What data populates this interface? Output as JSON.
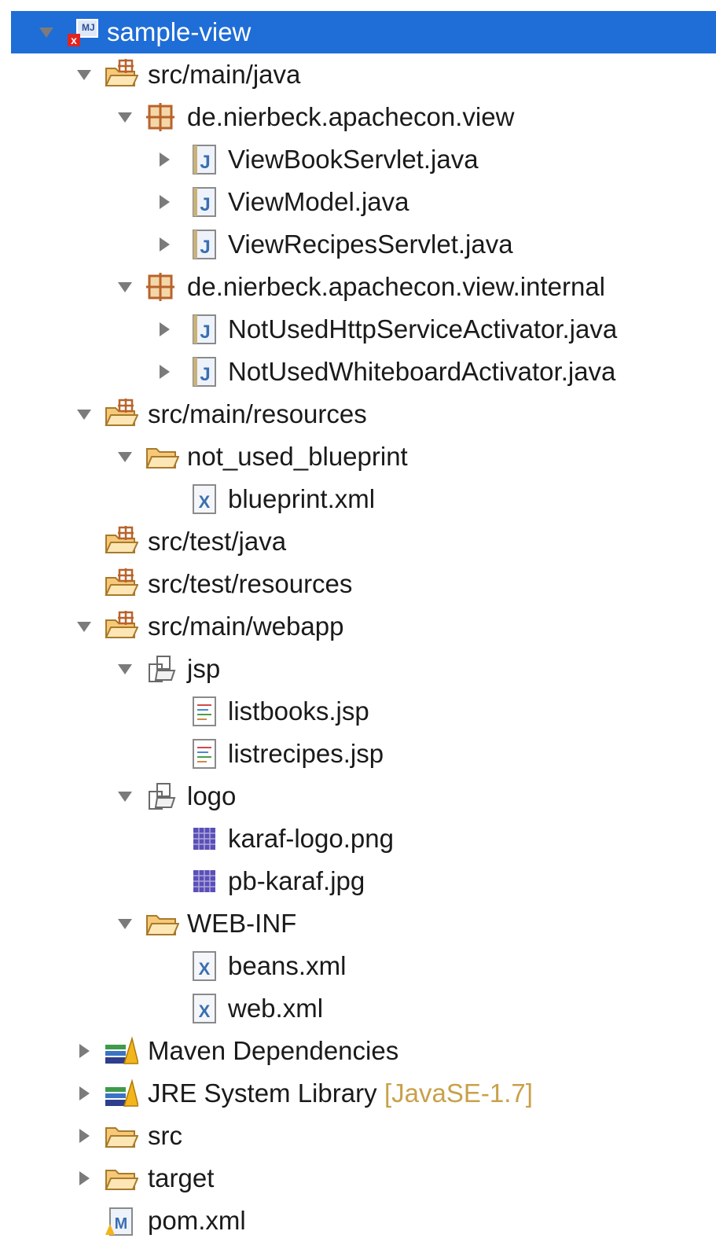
{
  "colors": {
    "selection": "#1f6dd6",
    "decoration": "#c8a14a",
    "folder": "#f6c97a",
    "package": "#b9632b",
    "java": "#3a6fb0",
    "image": "#5b4fb8"
  },
  "tree": [
    {
      "label": "sample-view",
      "icon": "maven-project-icon",
      "toggle": "expanded",
      "depth": 0,
      "selected": true
    },
    {
      "label": "src/main/java",
      "icon": "source-folder-icon",
      "toggle": "expanded",
      "depth": 1
    },
    {
      "label": "de.nierbeck.apachecon.view",
      "icon": "package-icon",
      "toggle": "expanded",
      "depth": 2
    },
    {
      "label": "ViewBookServlet.java",
      "icon": "java-file-icon",
      "toggle": "collapsed",
      "depth": 3
    },
    {
      "label": "ViewModel.java",
      "icon": "java-file-icon",
      "toggle": "collapsed",
      "depth": 3
    },
    {
      "label": "ViewRecipesServlet.java",
      "icon": "java-file-icon",
      "toggle": "collapsed",
      "depth": 3
    },
    {
      "label": "de.nierbeck.apachecon.view.internal",
      "icon": "package-icon",
      "toggle": "expanded",
      "depth": 2
    },
    {
      "label": "NotUsedHttpServiceActivator.java",
      "icon": "java-file-icon",
      "toggle": "collapsed",
      "depth": 3
    },
    {
      "label": "NotUsedWhiteboardActivator.java",
      "icon": "java-file-icon",
      "toggle": "collapsed",
      "depth": 3
    },
    {
      "label": "src/main/resources",
      "icon": "source-folder-icon",
      "toggle": "expanded",
      "depth": 1
    },
    {
      "label": "not_used_blueprint",
      "icon": "folder-icon",
      "toggle": "expanded",
      "depth": 2
    },
    {
      "label": "blueprint.xml",
      "icon": "xml-file-icon",
      "toggle": "none",
      "depth": 3
    },
    {
      "label": "src/test/java",
      "icon": "source-folder-icon",
      "toggle": "none",
      "depth": 1
    },
    {
      "label": "src/test/resources",
      "icon": "source-folder-icon",
      "toggle": "none",
      "depth": 1
    },
    {
      "label": "src/main/webapp",
      "icon": "source-folder-icon",
      "toggle": "expanded",
      "depth": 1
    },
    {
      "label": "jsp",
      "icon": "web-folder-icon",
      "toggle": "expanded",
      "depth": 2
    },
    {
      "label": "listbooks.jsp",
      "icon": "jsp-file-icon",
      "toggle": "none",
      "depth": 3
    },
    {
      "label": "listrecipes.jsp",
      "icon": "jsp-file-icon",
      "toggle": "none",
      "depth": 3
    },
    {
      "label": "logo",
      "icon": "web-folder-icon",
      "toggle": "expanded",
      "depth": 2
    },
    {
      "label": "karaf-logo.png",
      "icon": "image-file-icon",
      "toggle": "none",
      "depth": 3
    },
    {
      "label": "pb-karaf.jpg",
      "icon": "image-file-icon",
      "toggle": "none",
      "depth": 3
    },
    {
      "label": "WEB-INF",
      "icon": "folder-icon",
      "toggle": "expanded",
      "depth": 2
    },
    {
      "label": "beans.xml",
      "icon": "xml-file-icon",
      "toggle": "none",
      "depth": 3
    },
    {
      "label": "web.xml",
      "icon": "xml-file-icon",
      "toggle": "none",
      "depth": 3
    },
    {
      "label": "Maven Dependencies",
      "icon": "library-icon",
      "toggle": "collapsed",
      "depth": 1
    },
    {
      "label": "JRE System Library",
      "decoration": "[JavaSE-1.7]",
      "icon": "library-icon",
      "toggle": "collapsed",
      "depth": 1
    },
    {
      "label": "src",
      "icon": "folder-icon",
      "toggle": "collapsed",
      "depth": 1
    },
    {
      "label": "target",
      "icon": "folder-icon",
      "toggle": "collapsed",
      "depth": 1
    },
    {
      "label": "pom.xml",
      "icon": "maven-pom-icon",
      "toggle": "none",
      "depth": 1
    }
  ]
}
